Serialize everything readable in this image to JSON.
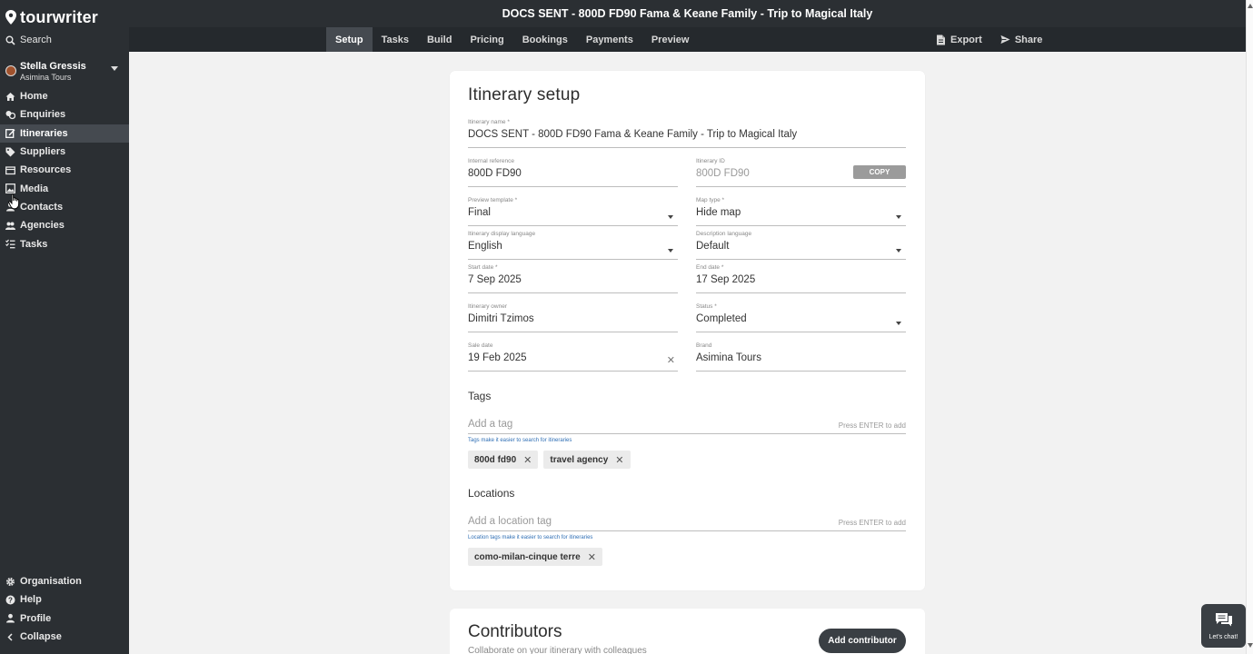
{
  "app": {
    "logo_text": "tourwriter",
    "window_title": "DOCS SENT - 800D FD90 Fama & Keane Family - Trip to Magical Italy"
  },
  "sidebar": {
    "search_label": "Search",
    "user": {
      "name": "Stella Gressis",
      "company": "Asimina Tours"
    },
    "items": [
      {
        "label": "Home",
        "icon": "home-icon"
      },
      {
        "label": "Enquiries",
        "icon": "enquiries-icon"
      },
      {
        "label": "Itineraries",
        "icon": "itineraries-icon",
        "active": true
      },
      {
        "label": "Suppliers",
        "icon": "tag-icon"
      },
      {
        "label": "Resources",
        "icon": "resources-icon"
      },
      {
        "label": "Media",
        "icon": "image-icon"
      },
      {
        "label": "Contacts",
        "icon": "contacts-icon"
      },
      {
        "label": "Agencies",
        "icon": "agencies-icon"
      },
      {
        "label": "Tasks",
        "icon": "tasks-icon"
      }
    ],
    "bottom_items": [
      {
        "label": "Organisation",
        "icon": "gear-icon"
      },
      {
        "label": "Help",
        "icon": "help-icon"
      },
      {
        "label": "Profile",
        "icon": "profile-icon"
      },
      {
        "label": "Collapse",
        "icon": "chevron-left-icon"
      }
    ]
  },
  "tabs": [
    "Setup",
    "Tasks",
    "Build",
    "Pricing",
    "Bookings",
    "Payments",
    "Preview"
  ],
  "active_tab": "Setup",
  "actions": {
    "export_label": "Export",
    "share_label": "Share"
  },
  "form": {
    "title": "Itinerary setup",
    "itinerary_name": {
      "label": "Itinerary name *",
      "value": "DOCS SENT - 800D FD90 Fama & Keane Family - Trip to Magical Italy"
    },
    "internal_reference": {
      "label": "Internal reference",
      "value": "800D FD90"
    },
    "itinerary_id": {
      "label": "Itinerary ID",
      "value": "800D FD90",
      "copy_label": "COPY"
    },
    "preview_template": {
      "label": "Preview template *",
      "value": "Final"
    },
    "map_type": {
      "label": "Map type *",
      "value": "Hide map"
    },
    "display_language": {
      "label": "Itinerary display language",
      "value": "English"
    },
    "description_language": {
      "label": "Description language",
      "value": "Default"
    },
    "start_date": {
      "label": "Start date *",
      "value": "7 Sep 2025"
    },
    "end_date": {
      "label": "End date *",
      "value": "17 Sep 2025"
    },
    "owner": {
      "label": "Itinerary owner",
      "value": "Dimitri Tzimos"
    },
    "status": {
      "label": "Status *",
      "value": "Completed"
    },
    "sale_date": {
      "label": "Sale date",
      "value": "19 Feb 2025"
    },
    "brand": {
      "label": "Brand",
      "value": "Asimina Tours"
    },
    "tags": {
      "title": "Tags",
      "placeholder": "Add a tag",
      "hint": "Press ENTER to add",
      "help": "Tags make it easier to search for itineraries",
      "chips": [
        "800d fd90",
        "travel agency"
      ]
    },
    "locations": {
      "title": "Locations",
      "placeholder": "Add a location tag",
      "hint": "Press ENTER to add",
      "help": "Location tags make it easier to search for itineraries",
      "chips": [
        "como-milan-cinque terre"
      ]
    }
  },
  "contributors": {
    "title": "Contributors",
    "subtitle": "Collaborate on your itinerary with colleagues",
    "add_label": "Add contributor"
  },
  "chat": {
    "label": "Let's chat!"
  },
  "colors": {
    "sidebar_bg": "#2b2f33",
    "active_bg": "#454a50",
    "link_blue": "#2f6fb5"
  }
}
